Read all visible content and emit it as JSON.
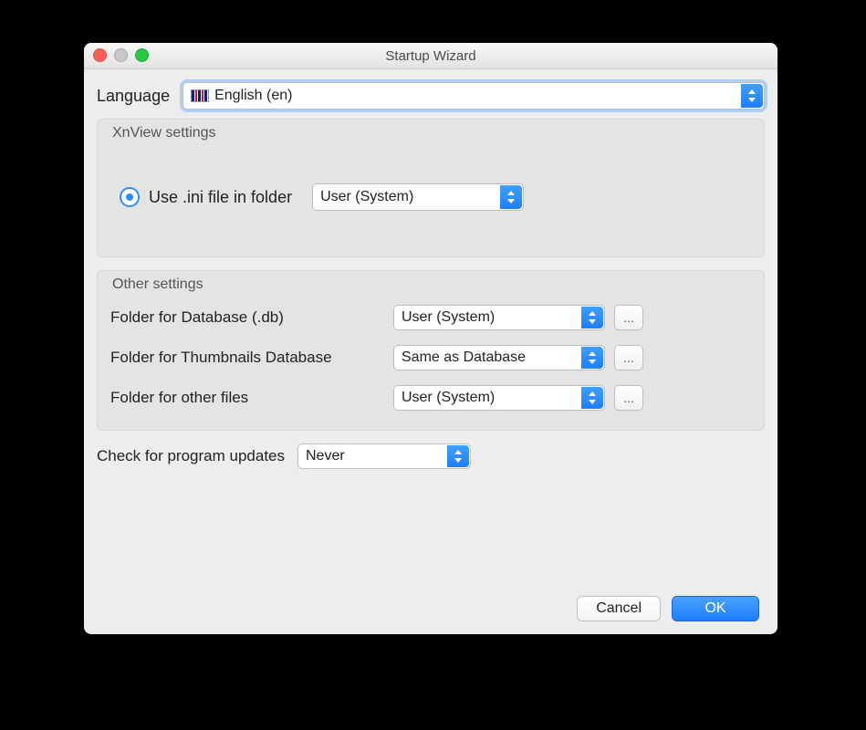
{
  "window": {
    "title": "Startup Wizard"
  },
  "language": {
    "label": "Language",
    "value": "English (en)",
    "flag": "uk-flag-icon"
  },
  "xnview_group": {
    "legend": "XnView settings",
    "radio_label": "Use .ini file in folder",
    "radio_checked": true,
    "ini_folder_value": "User (System)"
  },
  "other_group": {
    "legend": "Other settings",
    "rows": [
      {
        "label": "Folder for Database (.db)",
        "value": "User (System)"
      },
      {
        "label": "Folder for Thumbnails Database",
        "value": "Same as Database"
      },
      {
        "label": "Folder for other files",
        "value": "User (System)"
      }
    ],
    "browse_label": "..."
  },
  "updates": {
    "label": "Check for program updates",
    "value": "Never"
  },
  "buttons": {
    "cancel": "Cancel",
    "ok": "OK"
  }
}
